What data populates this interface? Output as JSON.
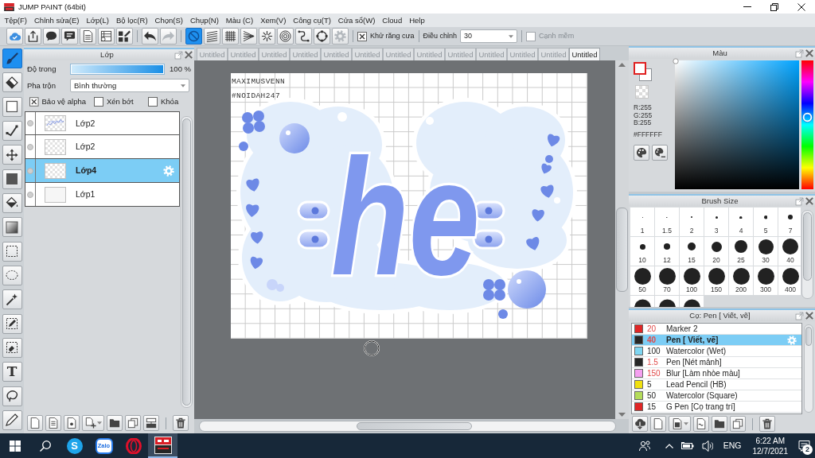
{
  "window": {
    "title": "JUMP PAINT (64bit)"
  },
  "menu": [
    "Tệp(F)",
    "Chỉnh sửa(E)",
    "Lớp(L)",
    "Bộ lọc(R)",
    "Chọn(S)",
    "Chụp(N)",
    "Màu (C)",
    "Xem(V)",
    "Công cụ(T)",
    "Cửa sổ(W)",
    "Cloud",
    "Help"
  ],
  "toolbar": {
    "file_buttons": [
      {
        "kind": "cloud"
      },
      {
        "kind": "upload"
      },
      {
        "kind": "speech"
      },
      {
        "kind": "comment"
      },
      {
        "kind": "page"
      },
      {
        "kind": "list"
      },
      {
        "kind": "gridedit"
      }
    ],
    "history_buttons": [
      {
        "kind": "undo",
        "disabled": false
      },
      {
        "kind": "redo",
        "disabled": true
      }
    ],
    "snap_buttons": [
      {
        "kind": "nosnap",
        "selected": true,
        "disabled": false
      },
      {
        "kind": "parallel",
        "selected": false,
        "disabled": false
      },
      {
        "kind": "grid",
        "selected": false,
        "disabled": false
      },
      {
        "kind": "fan",
        "selected": false,
        "disabled": false
      },
      {
        "kind": "radial",
        "selected": false,
        "disabled": false
      },
      {
        "kind": "rings",
        "selected": false,
        "disabled": false
      },
      {
        "kind": "curve",
        "selected": false,
        "disabled": false
      },
      {
        "kind": "ellipse",
        "selected": false,
        "disabled": false
      },
      {
        "kind": "gear",
        "selected": false,
        "disabled": true
      }
    ],
    "antialias": {
      "label": "Khử răng cưa",
      "checked": true
    },
    "adjust": {
      "label": "Điều chỉnh",
      "value": "30"
    },
    "soft_edge": {
      "label": "Cạnh mềm",
      "checked": false,
      "disabled": true
    }
  },
  "tools": [
    {
      "kind": "brush",
      "selected": true
    },
    {
      "kind": "eraser",
      "selected": false
    },
    {
      "kind": "rect",
      "selected": false
    },
    {
      "kind": "polyline",
      "selected": false
    },
    {
      "kind": "move",
      "selected": false
    },
    {
      "kind": "fill",
      "selected": false
    },
    {
      "kind": "bucket",
      "selected": false
    },
    {
      "kind": "gradient",
      "selected": false
    },
    {
      "kind": "marquee",
      "selected": false
    },
    {
      "kind": "lasso",
      "selected": false
    },
    {
      "kind": "wand",
      "selected": false
    },
    {
      "kind": "selpen",
      "selected": false
    },
    {
      "kind": "selerase",
      "selected": false
    },
    {
      "kind": "text",
      "label": "T",
      "selected": false
    },
    {
      "kind": "lassotool",
      "selected": false
    },
    {
      "kind": "pen",
      "selected": false
    }
  ],
  "layer_panel": {
    "title": "Lớp",
    "opacity": {
      "label": "Độ trong",
      "level": 1,
      "reading": "100 %"
    },
    "blend": {
      "label": "Pha trộn",
      "value": "Bình thường"
    },
    "options": [
      {
        "label": "Bảo vệ alpha",
        "checked": true
      },
      {
        "label": "Xén bớt",
        "checked": false
      },
      {
        "label": "Khóa",
        "checked": false
      }
    ],
    "layers": [
      {
        "name": "Lớp2",
        "kind": "sketch",
        "selected": false
      },
      {
        "name": "Lớp2",
        "kind": "checker",
        "selected": false
      },
      {
        "name": "Lớp4",
        "kind": "checker",
        "selected": true
      },
      {
        "name": "Lớp1",
        "kind": "plain",
        "selected": false
      }
    ],
    "buttons": [
      {
        "kind": "newpage"
      },
      {
        "kind": "textpage"
      },
      {
        "kind": "numpage"
      },
      {
        "kind": "addmenu"
      },
      {
        "kind": "folder"
      },
      {
        "kind": "copy"
      },
      {
        "kind": "merge"
      },
      {
        "kind": "trash"
      }
    ]
  },
  "document_tabs": [
    {
      "label": "Untitled",
      "selected": false
    },
    {
      "label": "Untitled",
      "selected": false
    },
    {
      "label": "Untitled",
      "selected": false
    },
    {
      "label": "Untitled",
      "selected": false
    },
    {
      "label": "Untitled",
      "selected": false
    },
    {
      "label": "Untitled",
      "selected": false
    },
    {
      "label": "Untitled",
      "selected": false
    },
    {
      "label": "Untitled",
      "selected": false
    },
    {
      "label": "Untitled",
      "selected": false
    },
    {
      "label": "Untitled",
      "selected": false
    },
    {
      "label": "Untitled",
      "selected": false
    },
    {
      "label": "Untitled",
      "selected": false
    },
    {
      "label": "Untitled",
      "selected": true
    }
  ],
  "canvas": {
    "signature": [
      "MAXIMUSVENN",
      "#NOIDAH247"
    ],
    "lettering": "he"
  },
  "color_panel": {
    "title": "Màu",
    "rgb": [
      "R:255",
      "G:255",
      "B:255"
    ],
    "hex": "#FFFFFF",
    "hue": {
      "level": 0.56
    }
  },
  "brush_size_panel": {
    "title": "Brush Size",
    "sizes": [
      "1",
      "1.5",
      "2",
      "3",
      "4",
      "5",
      "7",
      "10",
      "12",
      "15",
      "20",
      "25",
      "30",
      "40",
      "50",
      "70",
      "100",
      "150",
      "200",
      "300",
      "400"
    ]
  },
  "brush_panel": {
    "title": "Cọ: Pen [ Viết, vẽ]",
    "brushes": [
      {
        "color": "#e02626",
        "size": {
          "value": "20",
          "highlighted": true
        },
        "name": "Marker 2",
        "selected": false
      },
      {
        "color": "#262626",
        "size": {
          "value": "40",
          "highlighted": true
        },
        "name": "Pen [ Viết, vẽ]",
        "selected": true
      },
      {
        "color": "#7ed6f2",
        "size": {
          "value": "100",
          "highlighted": false
        },
        "name": "Watercolor (Wet)",
        "selected": false
      },
      {
        "color": "#262626",
        "size": {
          "value": "1.5",
          "highlighted": true
        },
        "name": "Pen [Nét mảnh]",
        "selected": false
      },
      {
        "color": "#f5a0f0",
        "size": {
          "value": "150",
          "highlighted": true
        },
        "name": "Blur [Làm nhòe màu]",
        "selected": false
      },
      {
        "color": "#f0e010",
        "size": {
          "value": "5",
          "highlighted": false
        },
        "name": "Lead Pencil (HB)",
        "selected": false
      },
      {
        "color": "#b4dc5a",
        "size": {
          "value": "50",
          "highlighted": false
        },
        "name": "Watercolor (Square)",
        "selected": false
      },
      {
        "color": "#e02626",
        "size": {
          "value": "15",
          "highlighted": false
        },
        "name": "G Pen [Cọ trang trí]",
        "selected": false
      }
    ],
    "buttons": [
      {
        "kind": "clouddown"
      },
      {
        "kind": "newpage"
      },
      {
        "kind": "pagemenu"
      },
      {
        "kind": "scriptpage"
      },
      {
        "kind": "folder"
      },
      {
        "kind": "copy"
      },
      {
        "kind": "trash"
      }
    ]
  },
  "taskbar": {
    "apps": [
      {
        "kind": "letter",
        "label": "S",
        "selected": false
      },
      {
        "kind": "wordmark",
        "label": "Zalo",
        "selected": false
      },
      {
        "kind": "ring",
        "selected": false
      },
      {
        "kind": "tile",
        "selected": true
      }
    ],
    "language": "ENG",
    "time": "6:22 AM",
    "date": "12/7/2021",
    "notification_count": "2"
  }
}
